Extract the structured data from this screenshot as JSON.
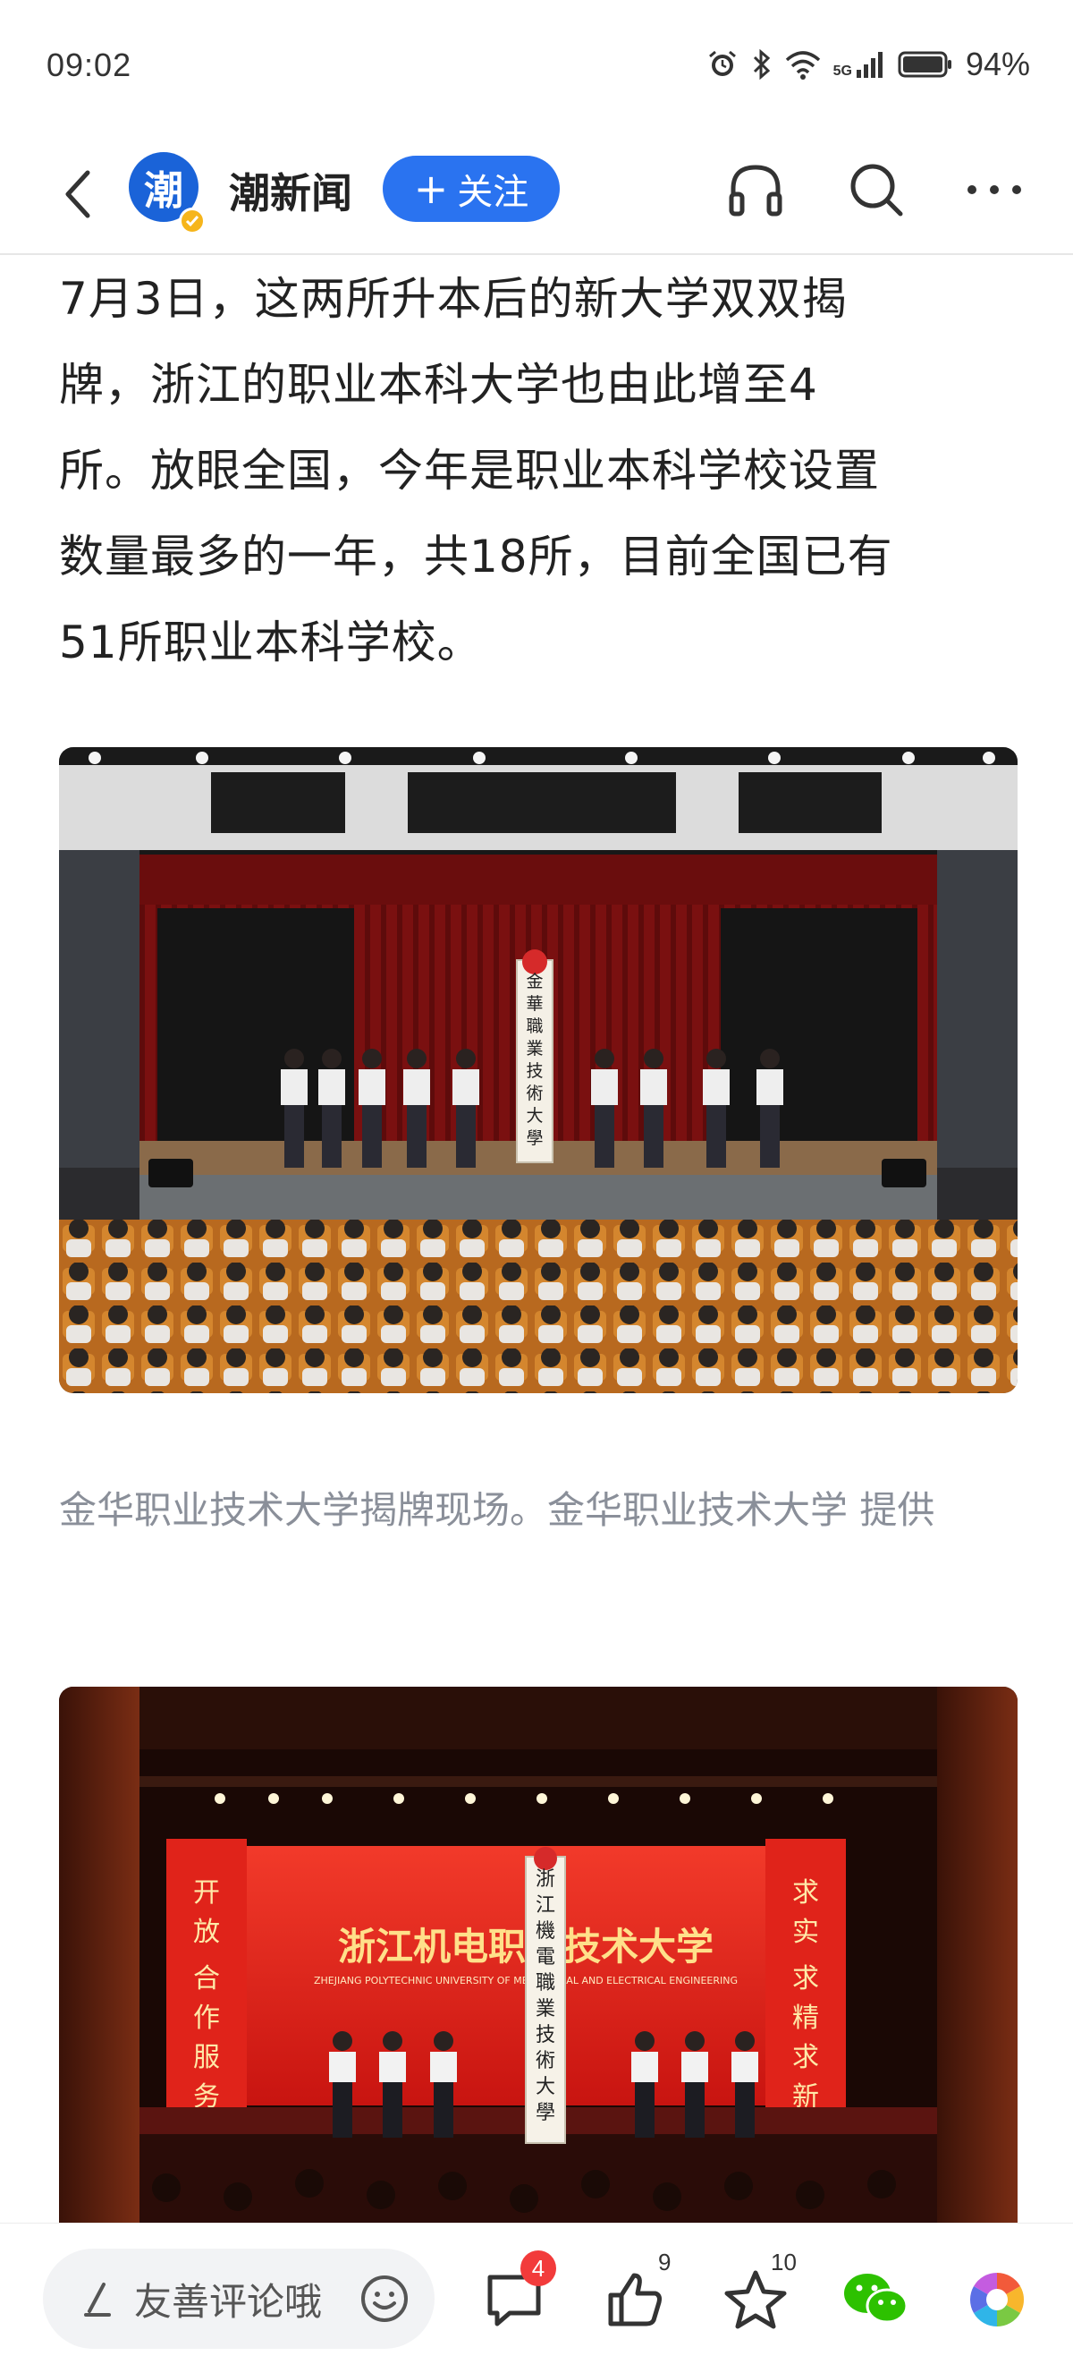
{
  "status_bar": {
    "time": "09:02",
    "network": "5G",
    "battery": "94%"
  },
  "header": {
    "channel_name": "潮新闻",
    "avatar_char": "潮",
    "follow_label": "关注",
    "follow_plus": "+"
  },
  "article": {
    "paragraph": [
      "7月3日，这两所升本后的新大学双双揭",
      "牌，浙江的职业本科大学也由此增至4",
      "所。放眼全国，今年是职业本科学校设置",
      "数量最多的一年，共18所，目前全国已有",
      "51所职业本科学校。"
    ],
    "caption_1": "金华职业技术大学揭牌现场。金华职业技术大学 提供",
    "photo_1": {
      "plaque_text": [
        "金",
        "華",
        "職",
        "業",
        "技",
        "術",
        "大",
        "學"
      ]
    },
    "photo_2": {
      "banner_title": "浙江机电职业技术大学",
      "banner_subtitle": "ZHEJIANG POLYTECHNIC UNIVERSITY OF MECHANICAL AND ELECTRICAL ENGINEERING",
      "left_banner": [
        "开",
        "放",
        "合",
        "作",
        "服",
        "务"
      ],
      "right_banner": [
        "求",
        "实",
        "求",
        "精",
        "求",
        "新"
      ],
      "plaque_text": [
        "浙",
        "江",
        "機",
        "電",
        "職",
        "業",
        "技",
        "術",
        "大",
        "學"
      ]
    }
  },
  "bottom_bar": {
    "comment_placeholder": "友善评论哦",
    "comment_count": "4",
    "like_count": "9",
    "favorite_count": "10"
  },
  "colors": {
    "accent": "#2a73f0",
    "badge_red": "#f23b3b",
    "caption_gray": "#8a8f99",
    "wechat_green": "#2dc100"
  },
  "icons": [
    "back-arrow-icon",
    "headphones-icon",
    "search-icon",
    "more-icon",
    "pen-icon",
    "emoji-icon",
    "comment-icon",
    "thumbs-up-icon",
    "star-icon",
    "wechat-icon",
    "moments-icon"
  ]
}
